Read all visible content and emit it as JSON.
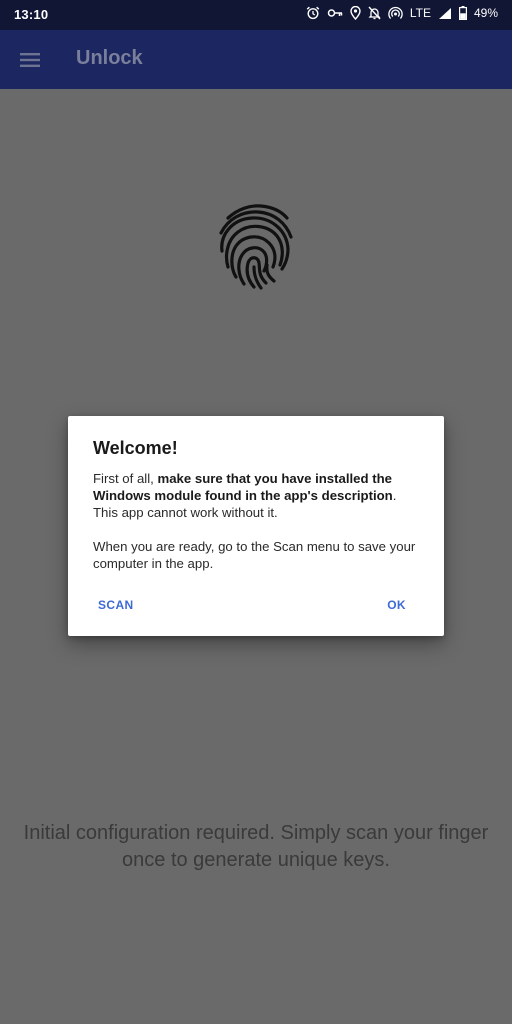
{
  "status_bar": {
    "time": "13:10",
    "network": "LTE",
    "battery": "49%",
    "icons": [
      "alarm-icon",
      "vpn-key-icon",
      "location-icon",
      "notifications-off-icon",
      "hotspot-icon",
      "signal-icon",
      "battery-icon"
    ]
  },
  "app_bar": {
    "title": "Unlock",
    "menu_icon": "menu-icon"
  },
  "main": {
    "icon": "fingerprint-icon",
    "message": "Initial configuration required. Simply scan your finger once to generate unique keys."
  },
  "dialog": {
    "title": "Welcome!",
    "para1_start": "First of all, ",
    "para1_bold": "make sure that you have installed the Windows module found in the app's description",
    "para1_end": ". This app cannot work without it.",
    "para2": "When you are ready, go to the Scan menu to save your computer in the app.",
    "scan_label": "SCAN",
    "ok_label": "OK"
  },
  "colors": {
    "status_bar_bg": "#101634",
    "app_bar_bg": "#1c2660",
    "scrim_bg": "#6a6a6a",
    "dialog_button": "#3d6ad6"
  }
}
